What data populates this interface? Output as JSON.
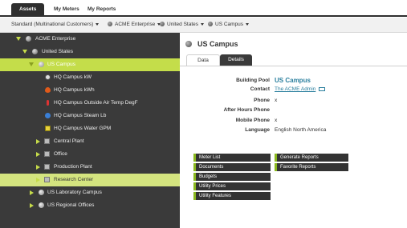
{
  "top_tabs": [
    "Assets",
    "My Meters",
    "My Reports"
  ],
  "breadcrumb": {
    "standard": "Standard (Multinational Customers)",
    "enterprise": "ACME Enterprise",
    "country": "United States",
    "campus": "US Campus"
  },
  "tree": {
    "enterprise": "ACME Enterprise",
    "country": "United States",
    "campus": "US Campus",
    "meters": [
      "HQ Campus kW",
      "HQ Campus kWh",
      "HQ Campus Outside Air Temp DegF",
      "HQ Campus Steam Lb",
      "HQ Campus Water GPM"
    ],
    "buildings": [
      "Central Plant",
      "Office",
      "Production Plant",
      "Research Center"
    ],
    "other_campuses": [
      "US Laboratory Campus",
      "US Regional Offices"
    ]
  },
  "detail": {
    "title": "US Campus",
    "tabs": [
      "Data",
      "Details"
    ],
    "fields": {
      "building_pool_label": "Building Pool",
      "building_pool_value": "US Campus",
      "contact_label": "Contact",
      "contact_value": "The ACME Admin",
      "phone_label": "Phone",
      "phone_value": "x",
      "after_hours_label": "After Hours Phone",
      "mobile_label": "Mobile Phone",
      "mobile_value": "x",
      "language_label": "Language",
      "language_value": "English North America"
    },
    "buttons_left": [
      "Meter List",
      "Documents",
      "Budgets",
      "Utility Prices",
      "Utility Features"
    ],
    "buttons_right": [
      "Generate Reports",
      "Favorite Reports"
    ]
  },
  "colors": {
    "accent": "#c4dd4a",
    "sidebar": "#3a3a3a",
    "link": "#2a7f9e"
  }
}
